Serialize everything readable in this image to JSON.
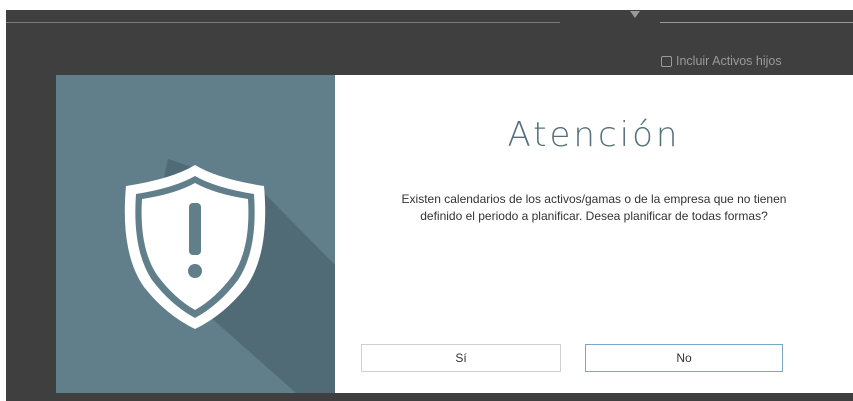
{
  "background": {
    "include_child_assets_label": "Incluir Activos hijos"
  },
  "dialog": {
    "title": "Atención",
    "message_line1": "Existen calendarios de los activos/gamas o de la empresa que no tienen",
    "message_line2": "definido el periodo a planificar. Desea planificar de todas formas?",
    "yes_label": "Sí",
    "no_label": "No",
    "icon": "warning-shield-icon",
    "colors": {
      "panel": "#617e8b",
      "title": "#54707d",
      "overlay": "#3f3f3f",
      "no_border": "#7ca6c2"
    }
  }
}
